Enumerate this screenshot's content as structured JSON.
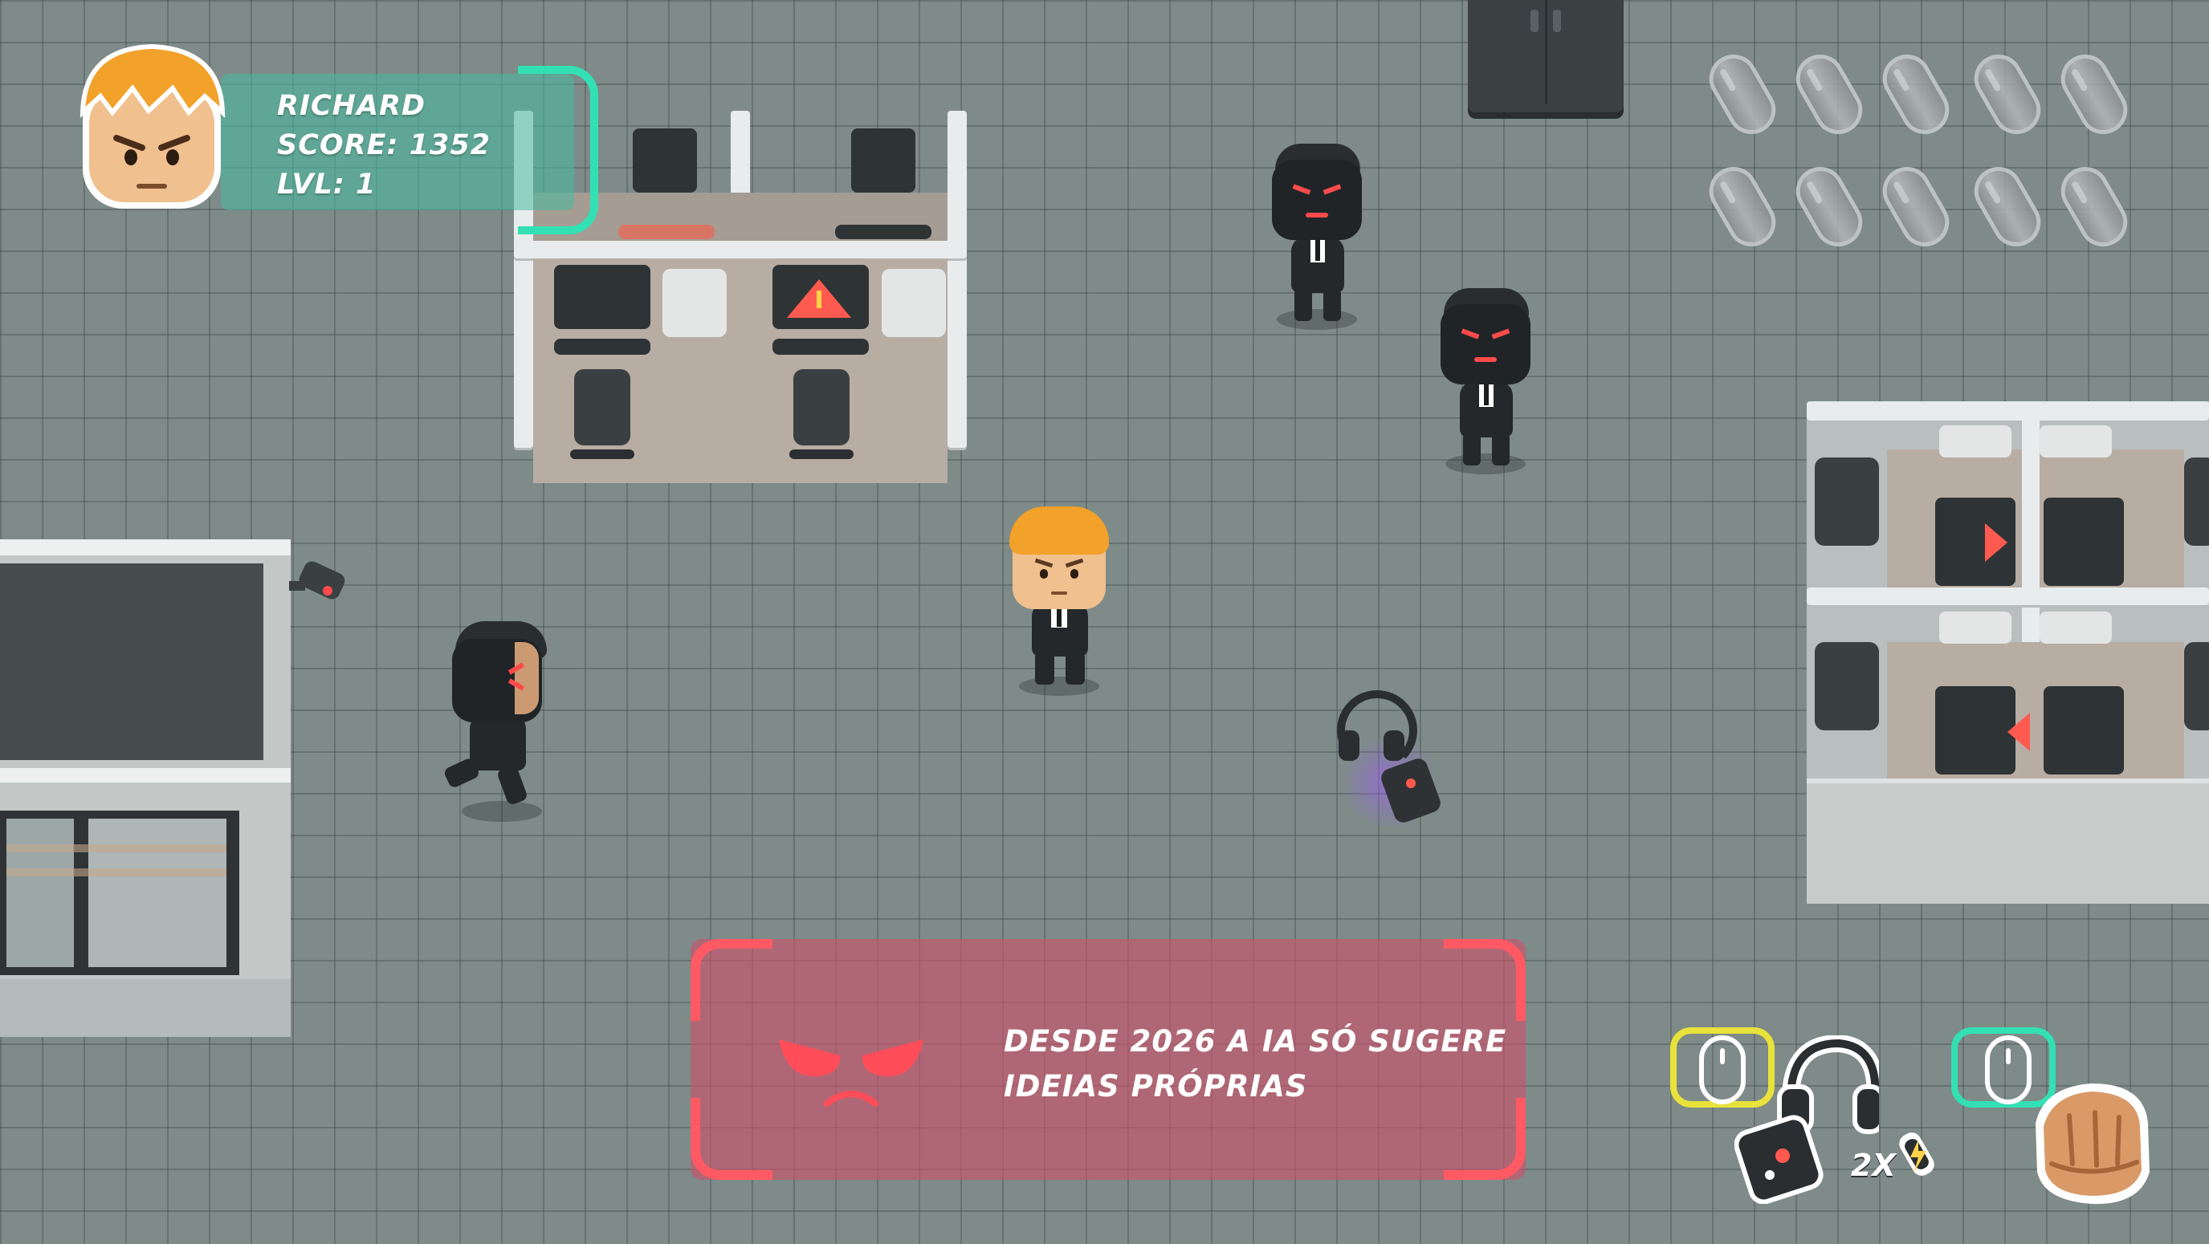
{
  "hud": {
    "name": "RICHARD",
    "score": "SCORE: 1352",
    "level": "LVL: 1"
  },
  "ammo": {
    "icon": "battery-icon",
    "slots_total": 10,
    "slots_filled": 0
  },
  "dialog": {
    "line1": "DESDE 2026 A IA SÓ SUGERE",
    "line2": "IDEIAS PRÓPRIAS",
    "icon": "angry-face-icon"
  },
  "controls": {
    "left_click": {
      "icon": "mouse-left-click-icon",
      "color": "#e8e23a",
      "item_icon": "headphones-player-icon"
    },
    "multiplier": "2X",
    "multiplier_icon": "battery-bolt-icon",
    "right_click": {
      "icon": "mouse-right-click-icon",
      "color": "#33e0b4",
      "item_icon": "fist-icon"
    }
  },
  "colors": {
    "hud_accent": "#33e0b4",
    "dialog_accent": "#ff5a64",
    "enemy_eyes": "#ff4b4b"
  }
}
